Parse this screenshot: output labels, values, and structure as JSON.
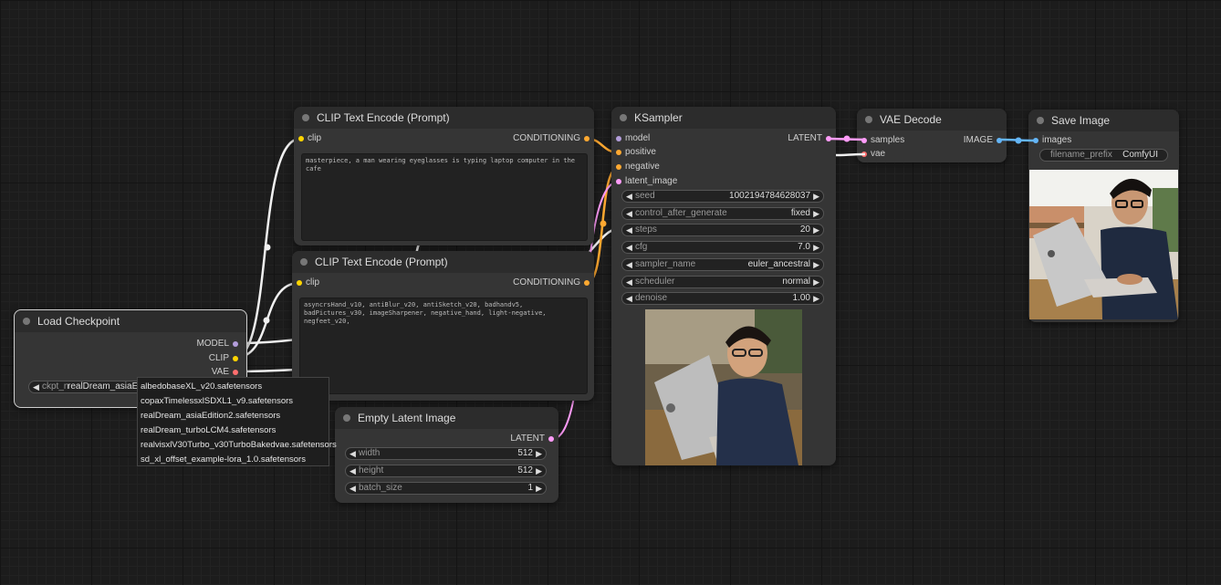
{
  "nodes": {
    "load_checkpoint": {
      "title": "Load Checkpoint",
      "outputs": [
        "MODEL",
        "CLIP",
        "VAE"
      ],
      "widget_name": "ckpt_n",
      "widget_value": "realDream_asiaEd"
    },
    "clip_pos": {
      "title": "CLIP Text Encode (Prompt)",
      "input": "clip",
      "output": "CONDITIONING",
      "text": "masterpiece, a man wearing eyeglasses is typing laptop computer in the cafe"
    },
    "clip_neg": {
      "title": "CLIP Text Encode (Prompt)",
      "input": "clip",
      "output": "CONDITIONING",
      "text": "asyncrsHand_v10, antiBlur_v20, antiSketch_v20, badhandv5, badPictures_v30, imageSharpener, negative_hand, light-negative, negfeet_v20,"
    },
    "empty_latent": {
      "title": "Empty Latent Image",
      "output": "LATENT",
      "widgets": [
        {
          "name": "width",
          "value": "512"
        },
        {
          "name": "height",
          "value": "512"
        },
        {
          "name": "batch_size",
          "value": "1"
        }
      ]
    },
    "ksampler": {
      "title": "KSampler",
      "inputs": [
        "model",
        "positive",
        "negative",
        "latent_image"
      ],
      "output": "LATENT",
      "widgets": [
        {
          "name": "seed",
          "value": "1002194784628037"
        },
        {
          "name": "control_after_generate",
          "value": "fixed"
        },
        {
          "name": "steps",
          "value": "20"
        },
        {
          "name": "cfg",
          "value": "7.0"
        },
        {
          "name": "sampler_name",
          "value": "euler_ancestral"
        },
        {
          "name": "scheduler",
          "value": "normal"
        },
        {
          "name": "denoise",
          "value": "1.00"
        }
      ]
    },
    "vae_decode": {
      "title": "VAE Decode",
      "inputs": [
        "samples",
        "vae"
      ],
      "output": "IMAGE"
    },
    "save_image": {
      "title": "Save Image",
      "input": "images",
      "widget_name": "filename_prefix",
      "widget_value": "ComfyUI"
    }
  },
  "ckpt_dropdown": [
    "albedobaseXL_v20.safetensors",
    "copaxTimelessxlSDXL1_v9.safetensors",
    "realDream_asiaEdition2.safetensors",
    "realDream_turboLCM4.safetensors",
    "realvisxlV30Turbo_v30TurboBakedvae.safetensors",
    "sd_xl_offset_example-lora_1.0.safetensors"
  ],
  "colors": {
    "clip": "#ffd500",
    "conditioning": "#ffa931",
    "model": "#b39ddb",
    "latent": "#ff9cf9",
    "vae": "#ff6e6e",
    "image": "#64b5f6"
  }
}
